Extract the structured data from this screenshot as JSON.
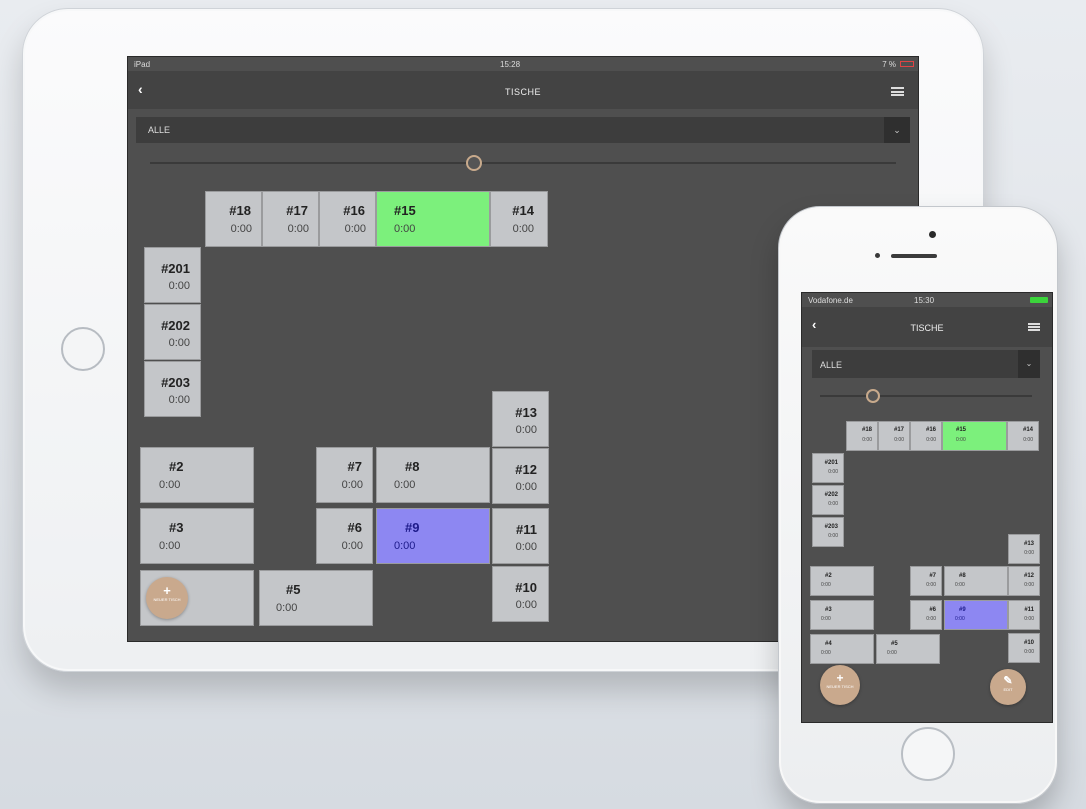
{
  "ipad": {
    "status": {
      "carrier": "iPad",
      "time": "15:28",
      "battery": "7 %"
    },
    "nav": {
      "back": "‹",
      "title": "TISCHE"
    },
    "filter": {
      "value": "ALLE",
      "caret": "⌄"
    },
    "fab": {
      "plus": "+",
      "label": "NEUER TISCH"
    },
    "tables": {
      "t18": {
        "name": "#18",
        "time": "0:00"
      },
      "t17": {
        "name": "#17",
        "time": "0:00"
      },
      "t16": {
        "name": "#16",
        "time": "0:00"
      },
      "t15": {
        "name": "#15",
        "time": "0:00",
        "status": "green"
      },
      "t14": {
        "name": "#14",
        "time": "0:00"
      },
      "t201": {
        "name": "#201",
        "time": "0:00"
      },
      "t202": {
        "name": "#202",
        "time": "0:00"
      },
      "t203": {
        "name": "#203",
        "time": "0:00"
      },
      "t13": {
        "name": "#13",
        "time": "0:00"
      },
      "t2": {
        "name": "#2",
        "time": "0:00"
      },
      "t7": {
        "name": "#7",
        "time": "0:00"
      },
      "t8": {
        "name": "#8",
        "time": "0:00"
      },
      "t12": {
        "name": "#12",
        "time": "0:00"
      },
      "t3": {
        "name": "#3",
        "time": "0:00"
      },
      "t6": {
        "name": "#6",
        "time": "0:00"
      },
      "t9": {
        "name": "#9",
        "time": "0:00",
        "status": "purple"
      },
      "t11": {
        "name": "#11",
        "time": "0:00"
      },
      "t5": {
        "name": "#5",
        "time": "0:00"
      },
      "t10": {
        "name": "#10",
        "time": "0:00"
      }
    }
  },
  "iphone": {
    "status": {
      "carrier": "Vodafone.de",
      "time": "15:30"
    },
    "nav": {
      "back": "‹",
      "title": "TISCHE"
    },
    "filter": {
      "value": "ALLE",
      "caret": "⌄"
    },
    "fab_new": {
      "plus": "+",
      "label": "NEUER TISCH"
    },
    "fab_edit": {
      "icon": "✎",
      "label": "EDIT"
    },
    "tables": {
      "t18": {
        "name": "#18",
        "time": "0:00"
      },
      "t17": {
        "name": "#17",
        "time": "0:00"
      },
      "t16": {
        "name": "#16",
        "time": "0:00"
      },
      "t15": {
        "name": "#15",
        "time": "0:00"
      },
      "t14": {
        "name": "#14",
        "time": "0:00"
      },
      "t201": {
        "name": "#201",
        "time": "0:00"
      },
      "t202": {
        "name": "#202",
        "time": "0:00"
      },
      "t203": {
        "name": "#203",
        "time": "0:00"
      },
      "t13": {
        "name": "#13",
        "time": "0:00"
      },
      "t2": {
        "name": "#2",
        "time": "0:00"
      },
      "t7": {
        "name": "#7",
        "time": "0:00"
      },
      "t8": {
        "name": "#8",
        "time": "0:00"
      },
      "t12": {
        "name": "#12",
        "time": "0:00"
      },
      "t3": {
        "name": "#3",
        "time": "0:00"
      },
      "t6": {
        "name": "#6",
        "time": "0:00"
      },
      "t9": {
        "name": "#9",
        "time": "0:00"
      },
      "t11": {
        "name": "#11",
        "time": "0:00"
      },
      "t4": {
        "name": "#4",
        "time": "0:00"
      },
      "t5": {
        "name": "#5",
        "time": "0:00"
      },
      "t10": {
        "name": "#10",
        "time": "0:00"
      }
    }
  },
  "colors": {
    "occupied": "#7cf07c",
    "selected": "#8d87f2",
    "free": "#c4c6c9",
    "accent": "#c9a98d"
  }
}
